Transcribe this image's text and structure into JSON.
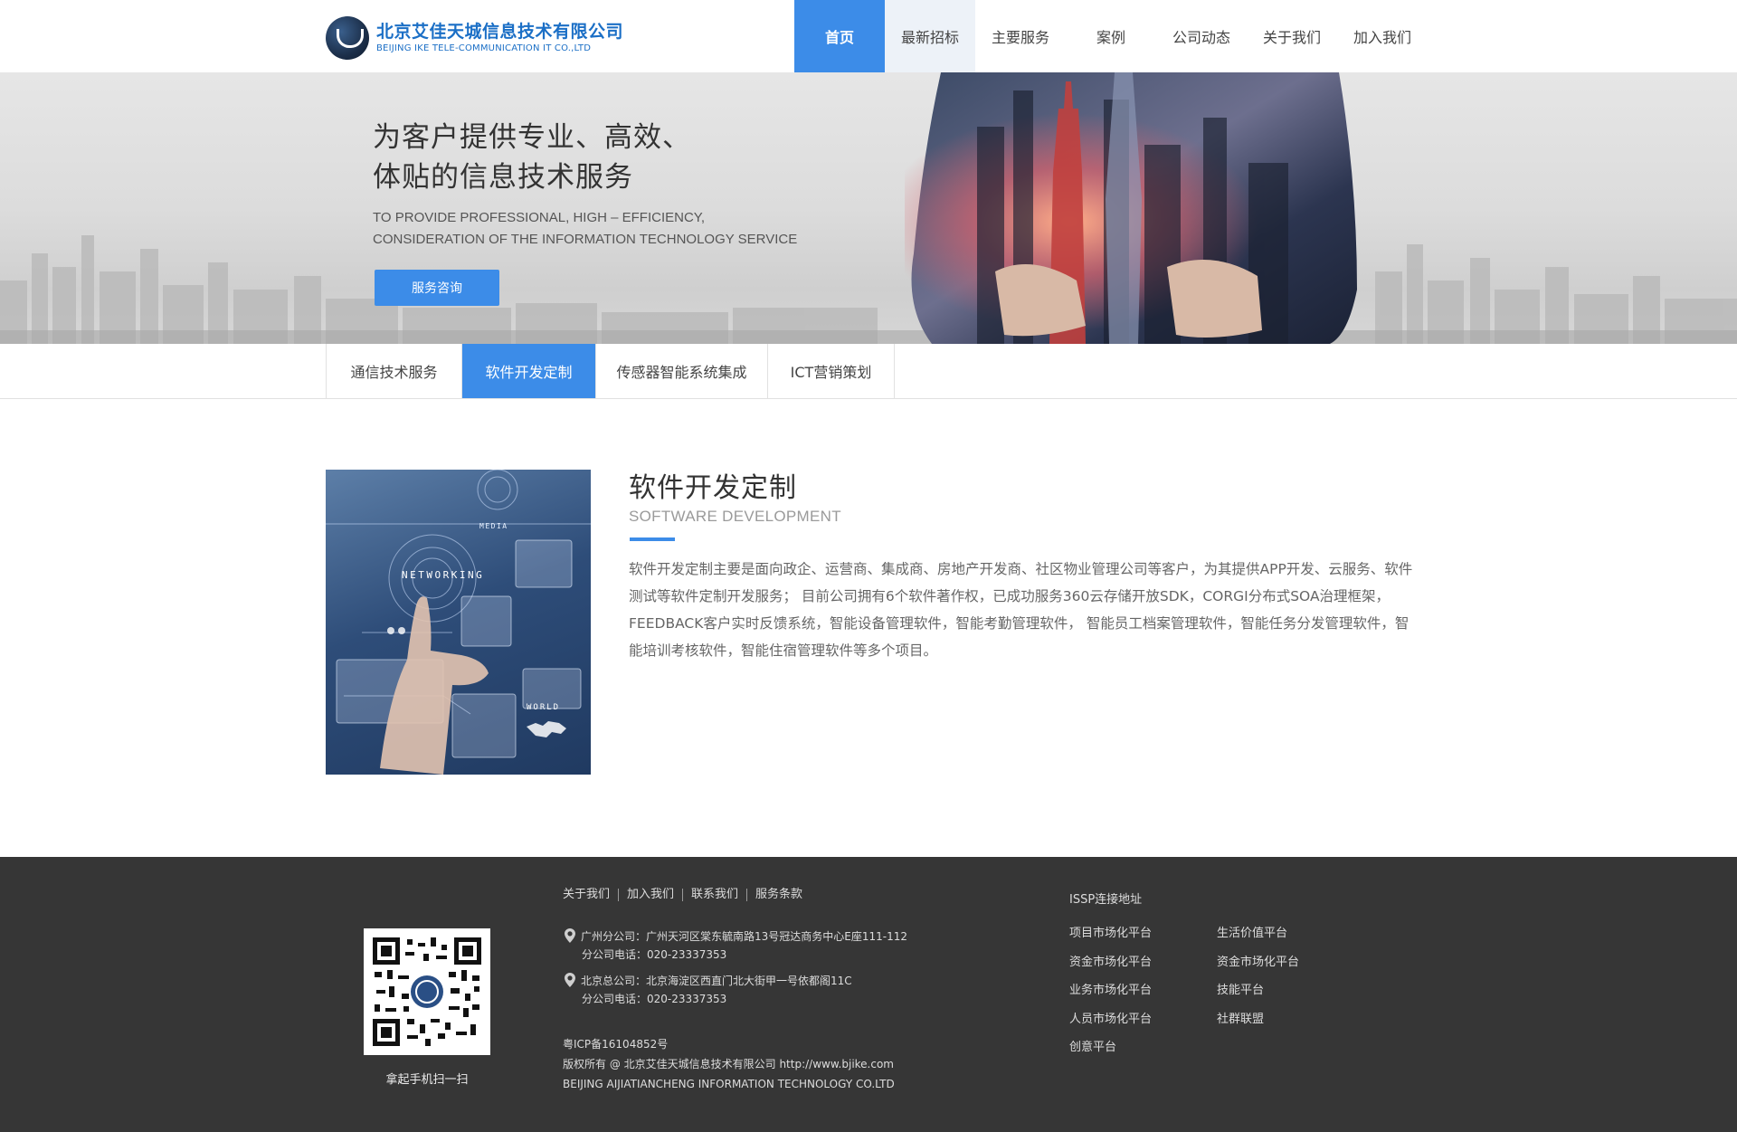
{
  "header": {
    "logo_cn": "北京艾佳天城信息技术有限公司",
    "logo_en": "BEIJING IKE TELE-COMMUNICATION IT CO.,LTD",
    "nav": [
      "首页",
      "最新招标",
      "主要服务",
      "案例",
      "公司动态",
      "关于我们",
      "加入我们"
    ]
  },
  "banner": {
    "headline_1": "为客户提供专业、高效、",
    "headline_2": "体贴的信息技术服务",
    "en_1": "TO PROVIDE PROFESSIONAL, HIGH – EFFICIENCY,",
    "en_2": "CONSIDERATION OF THE INFORMATION TECHNOLOGY SERVICE",
    "button": "服务咨询"
  },
  "tabs": [
    "通信技术服务",
    "软件开发定制",
    "传感器智能系统集成",
    "ICT营销策划"
  ],
  "content": {
    "title": "软件开发定制",
    "subtitle": "SOFTWARE DEVELOPMENT",
    "body": "软件开发定制主要是面向政企、运营商、集成商、房地产开发商、社区物业管理公司等客户，为其提供APP开发、云服务、软件测试等软件定制开发服务； 目前公司拥有6个软件著作权，已成功服务360云存储开放SDK，CORGI分布式SOA治理框架，FEEDBACK客户实时反馈系统，智能设备管理软件，智能考勤管理软件， 智能员工档案管理软件，智能任务分发管理软件，智能培训考核软件，智能住宿管理软件等多个项目。",
    "image_text": {
      "networking": "NETWORKING",
      "media": "MEDIA",
      "world": "WORLD"
    }
  },
  "footer": {
    "qr_caption": "拿起手机扫一扫",
    "links": [
      "关于我们",
      "加入我们",
      "联系我们",
      "服务条款"
    ],
    "addr1_line1": "广州分公司：广州天河区棠东毓南路13号冠达商务中心E座111-112",
    "addr1_line2": "分公司电话：020-23337353",
    "addr2_line1": "北京总公司：北京海淀区西直门北大街甲一号依都阁11C",
    "addr2_line2": "分公司电话：020-23337353",
    "icp": "粤ICP备16104852号",
    "copyright": "版权所有 @ 北京艾佳天城信息技术有限公司 http://www.bjike.com",
    "company_en": "BEIJING AIJIATIANCHENG INFORMATION TECHNOLOGY CO.LTD",
    "issp_title": "ISSP连接地址",
    "issp_col1": [
      "项目市场化平台",
      "资金市场化平台",
      "业务市场化平台",
      "人员市场化平台",
      "创意平台"
    ],
    "issp_col2": [
      "生活价值平台",
      "资金市场化平台",
      "技能平台",
      "社群联盟"
    ]
  },
  "colors": {
    "accent": "#3c8ce8",
    "footer_bg": "#363636",
    "logo_blue": "#1b6fc6"
  }
}
